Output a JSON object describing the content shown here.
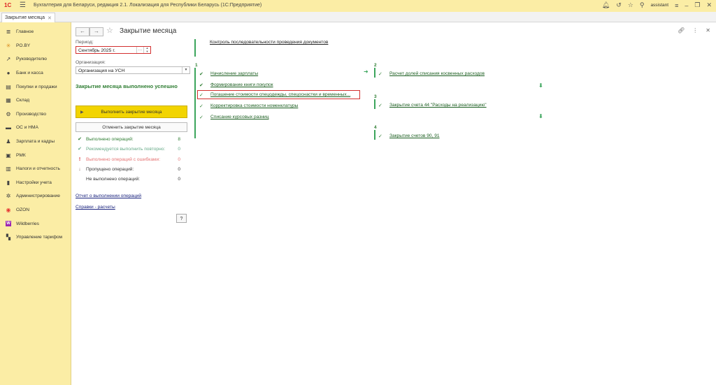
{
  "app": {
    "title": "Бухгалтерия для Беларуси, редакция 2.1. Локализация для Республики Беларусь   (1С:Предприятие)",
    "logo": "1С",
    "user": "assistant"
  },
  "tabs": [
    {
      "label": "Закрытие месяца"
    }
  ],
  "sidebar": {
    "items": [
      {
        "label": "Главное",
        "icon": "menu-icon"
      },
      {
        "label": "PO.BY",
        "icon": "asterisk-icon"
      },
      {
        "label": "Руководителю",
        "icon": "trend-icon"
      },
      {
        "label": "Банк и касса",
        "icon": "coins-icon"
      },
      {
        "label": "Покупки и продажи",
        "icon": "cart-icon"
      },
      {
        "label": "Склад",
        "icon": "warehouse-icon"
      },
      {
        "label": "Производство",
        "icon": "factory-icon"
      },
      {
        "label": "ОС и НМА",
        "icon": "truck-icon"
      },
      {
        "label": "Зарплата и кадры",
        "icon": "person-icon"
      },
      {
        "label": "РМК",
        "icon": "register-icon"
      },
      {
        "label": "Налоги и отчетность",
        "icon": "chart-icon"
      },
      {
        "label": "Настройки учета",
        "icon": "book-icon"
      },
      {
        "label": "Администрирование",
        "icon": "gear-icon"
      },
      {
        "label": "OZON",
        "icon": "ozon-icon"
      },
      {
        "label": "Wildberries",
        "icon": "wildberries-icon"
      },
      {
        "label": "Управление тарифом",
        "icon": "grid-icon"
      }
    ]
  },
  "page": {
    "title": "Закрытие месяца",
    "period_label": "Период:",
    "period_value": "Сентябрь 2025 г.",
    "org_label": "Организация:",
    "org_value": "Организация на УСН",
    "success_text": "Закрытие месяца выполнено успешно",
    "run_button": "Выполнить закрытие месяца",
    "cancel_button": "Отменить закрытие месяца",
    "stats": [
      {
        "label": "Выполнено операций:",
        "value": "8",
        "color": "#2e7d32"
      },
      {
        "label": "Рекомендуется выполнить повторно:",
        "value": "0",
        "color": "#66aa88"
      },
      {
        "label": "Выполнено операций с ошибками:",
        "value": "0",
        "color": "#e57373"
      },
      {
        "label": "Пропущено операций:",
        "value": "0",
        "color": "#333333"
      },
      {
        "label": "Не выполнено операций:",
        "value": "0",
        "color": "#333333"
      }
    ],
    "report_link": "Отчет о выполнении операций",
    "help_link": "Справки - расчеты",
    "help_button": "?"
  },
  "workflow": {
    "top_link": "Контроль последовательности проведения документов",
    "step1": {
      "number": "1",
      "items": [
        "Начисление зарплаты",
        "Формирование книги покупок",
        "Погашение стоимости спецодежды, спецоснастки и временных...",
        "Корректировка стоимости номенклатуры",
        "Списание курсовых разниц"
      ]
    },
    "step2": {
      "number": "2",
      "items": [
        "Расчет долей списания косвенных расходов"
      ]
    },
    "step3": {
      "number": "3",
      "items": [
        "Закрытие счета 44 \"Расходы на реализацию\""
      ]
    },
    "step4": {
      "number": "4",
      "items": [
        "Закрытие счетов 90, 91"
      ]
    }
  },
  "colors": {
    "accent": "#f2d400",
    "sidebar": "#fbeda5",
    "success": "#2e7d32",
    "highlight": "#d32f2f"
  }
}
